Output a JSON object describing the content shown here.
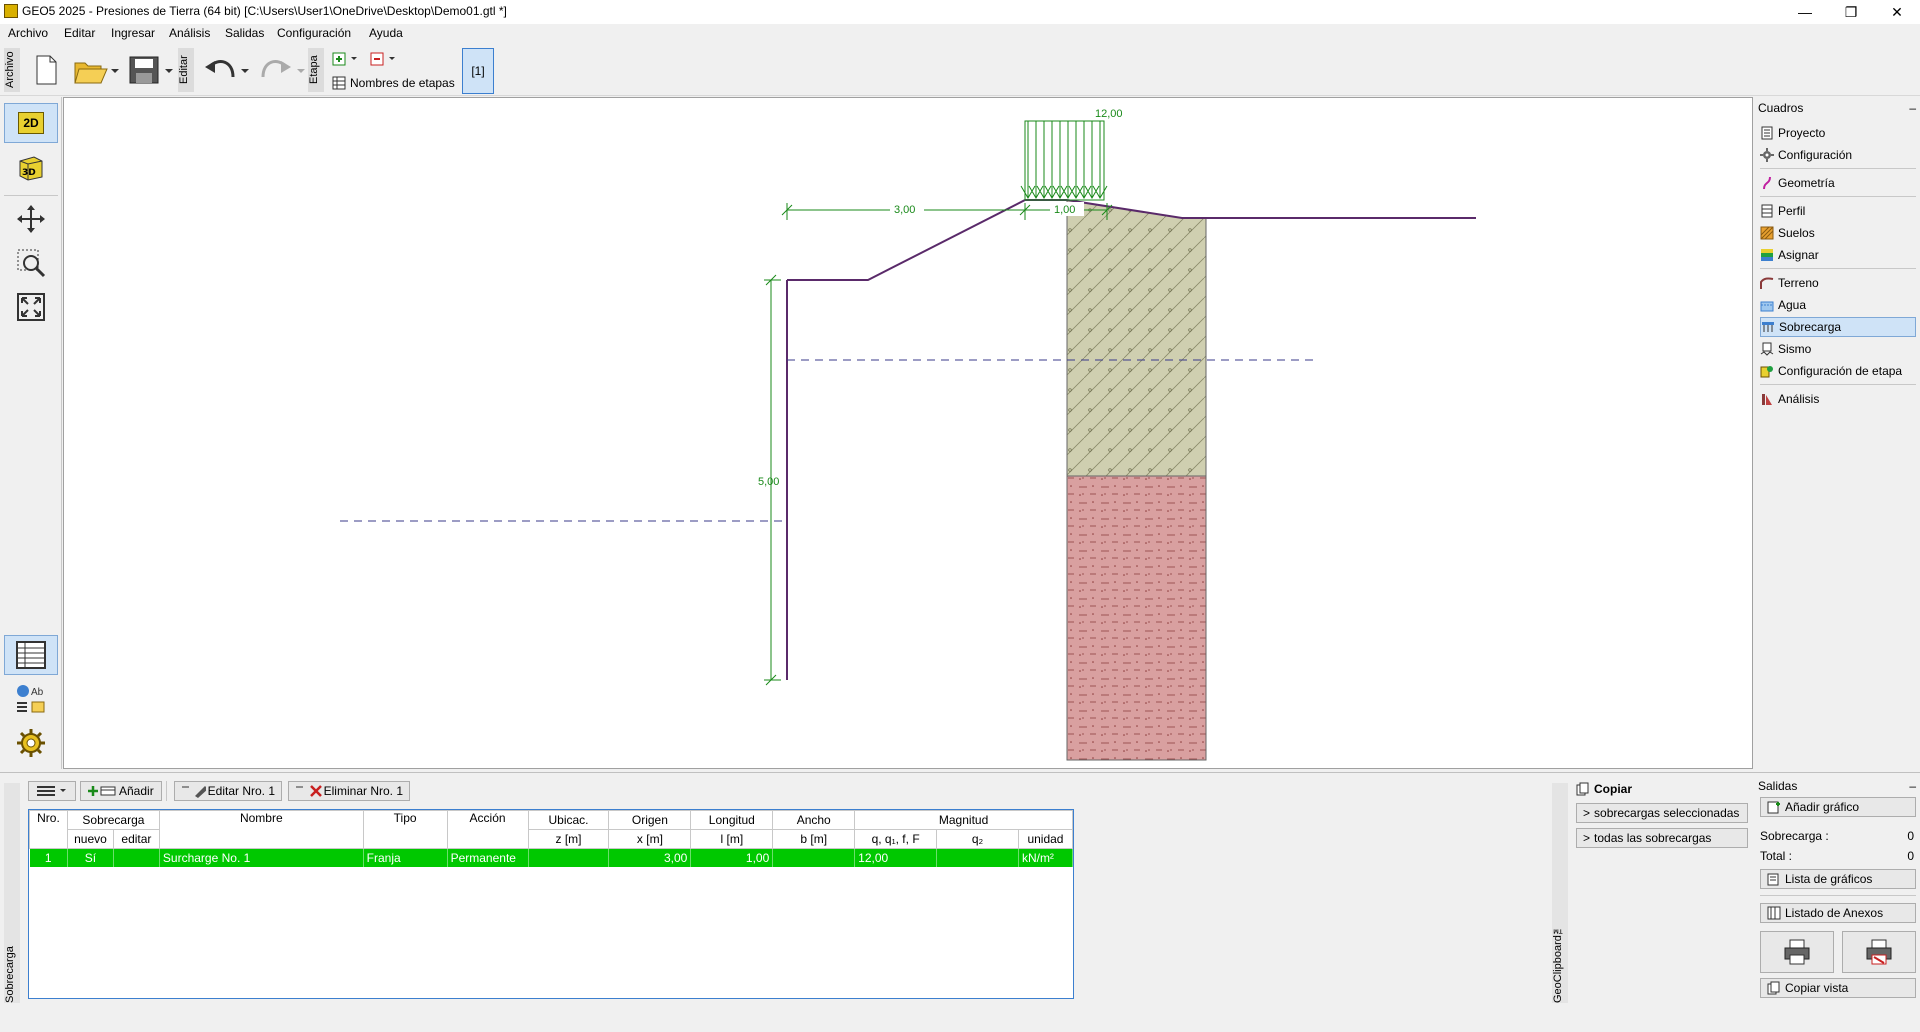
{
  "window": {
    "title": "GEO5 2025 - Presiones de Tierra (64 bit) [C:\\Users\\User1\\OneDrive\\Desktop\\Demo01.gtl *]",
    "minimize": "—",
    "restore": "❐",
    "close": "✕"
  },
  "menu": [
    "Archivo",
    "Editar",
    "Ingresar",
    "Análisis",
    "Salidas",
    "Configuración",
    "Ayuda"
  ],
  "toolbar": {
    "archivo_label": "Archivo",
    "editar_label": "Editar",
    "etapa_label": "Etapa",
    "stage_names": "Nombres de etapas",
    "stage_button": "[1]"
  },
  "left_toolbar": {
    "btn_2d": "2D",
    "btn_3d": "3D",
    "ab": "Ab"
  },
  "drawing": {
    "load_value": "12,00",
    "dim_left": "3,00",
    "dim_right": "1,00",
    "dim_height": "5,00"
  },
  "right_panel": {
    "title": "Cuadros",
    "collapse": "–",
    "items": [
      {
        "label": "Proyecto",
        "icon": "document-icon"
      },
      {
        "label": "Configuración",
        "icon": "gear-icon"
      },
      {
        "label": "Geometría",
        "icon": "geometry-icon"
      },
      {
        "label": "Perfil",
        "icon": "profile-icon"
      },
      {
        "label": "Suelos",
        "icon": "soils-icon"
      },
      {
        "label": "Asignar",
        "icon": "assign-icon"
      },
      {
        "label": "Terreno",
        "icon": "terrain-icon"
      },
      {
        "label": "Agua",
        "icon": "water-icon"
      },
      {
        "label": "Sobrecarga",
        "icon": "surcharge-icon"
      },
      {
        "label": "Sismo",
        "icon": "earthquake-icon"
      },
      {
        "label": "Configuración de etapa",
        "icon": "stage-settings-icon"
      },
      {
        "label": "Análisis",
        "icon": "analysis-icon"
      }
    ]
  },
  "bottom_toolbar": {
    "add": "Añadir",
    "edit": "Editar Nro. 1",
    "delete": "Eliminar Nro. 1"
  },
  "side_tab": "Sobrecarga",
  "table": {
    "header_top": [
      "Nro.",
      "Sobrecarga",
      "Nombre",
      "Tipo",
      "Acción",
      "Ubicac.",
      "Origen",
      "Longitud",
      "Ancho",
      "Magnitud"
    ],
    "header_bottom": [
      "nuevo",
      "editar",
      "z [m]",
      "x [m]",
      "l [m]",
      "b [m]",
      "q, q₁, f, F",
      "q₂",
      "unidad"
    ],
    "rows": [
      {
        "nro": "1",
        "nuevo": "Sí",
        "editar": "",
        "nombre": "Surcharge No. 1",
        "tipo": "Franja",
        "accion": "Permanente",
        "z": "",
        "x": "3,00",
        "l": "1,00",
        "b": "",
        "q1": "12,00",
        "q2": "",
        "unidad": "kN/m²"
      }
    ]
  },
  "clipboard": {
    "tab": "GeoClipboard™",
    "title": "Copiar",
    "btn_selected": "sobrecargas seleccionadas",
    "btn_all": "todas las sobrecargas"
  },
  "outputs": {
    "title": "Salidas",
    "collapse": "–",
    "add_graphic": "Añadir gráfico",
    "sobrecarga_label": "Sobrecarga :",
    "sobrecarga_value": "0",
    "total_label": "Total :",
    "total_value": "0",
    "graphics_list": "Lista de gráficos",
    "annex_list": "Listado de Anexos",
    "copy_view": "Copiar vista"
  },
  "colors": {
    "selection_green": "#00c800",
    "soil_top": "#cfcfb0",
    "soil_bottom": "#d9a0a0",
    "load_green": "#1a8a1a",
    "wall_purple": "#5a2a6a",
    "accent_blue": "#3c7fcf"
  }
}
